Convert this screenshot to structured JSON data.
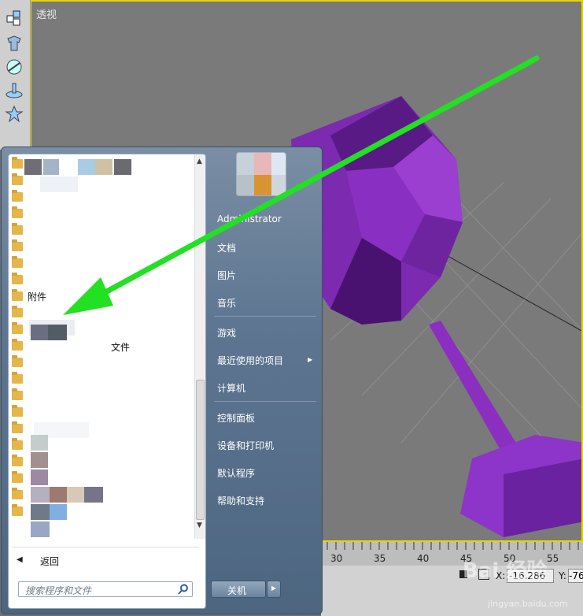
{
  "viewport": {
    "title": "透视"
  },
  "timeline": {
    "ticks": [
      "30",
      "35",
      "40",
      "45",
      "50",
      "55"
    ],
    "x_label": "X:",
    "x_value": "-16.286",
    "y_label": "Y:",
    "y_value": "-76"
  },
  "start_menu": {
    "programs": [
      {
        "label": ""
      },
      {
        "label": ""
      },
      {
        "label": ""
      },
      {
        "label": ""
      },
      {
        "label": ""
      },
      {
        "label": ""
      },
      {
        "label": ""
      },
      {
        "label": ""
      },
      {
        "label": "附件"
      },
      {
        "label": ""
      },
      {
        "label": ""
      },
      {
        "label": ""
      },
      {
        "label": ""
      },
      {
        "label": ""
      },
      {
        "label": ""
      },
      {
        "label": ""
      },
      {
        "label": ""
      },
      {
        "label": ""
      },
      {
        "label": ""
      },
      {
        "label": ""
      },
      {
        "label": ""
      },
      {
        "label": ""
      }
    ],
    "partial_text": "文件",
    "back_label": "返回",
    "search_placeholder": "搜索程序和文件",
    "user_name": "Administrator",
    "right_links": [
      "文档",
      "图片",
      "音乐",
      "游戏",
      "最近使用的项目",
      "计算机",
      "控制面板",
      "设备和打印机",
      "默认程序",
      "帮助和支持"
    ],
    "shutdown_label": "关机"
  },
  "watermark": {
    "text": "Bai 经验",
    "sub": "jingyan.baidu.com"
  },
  "colors": {
    "viewport_border": "#e8d400",
    "arrow": "#22e022",
    "glass": "#8a2fc0"
  }
}
